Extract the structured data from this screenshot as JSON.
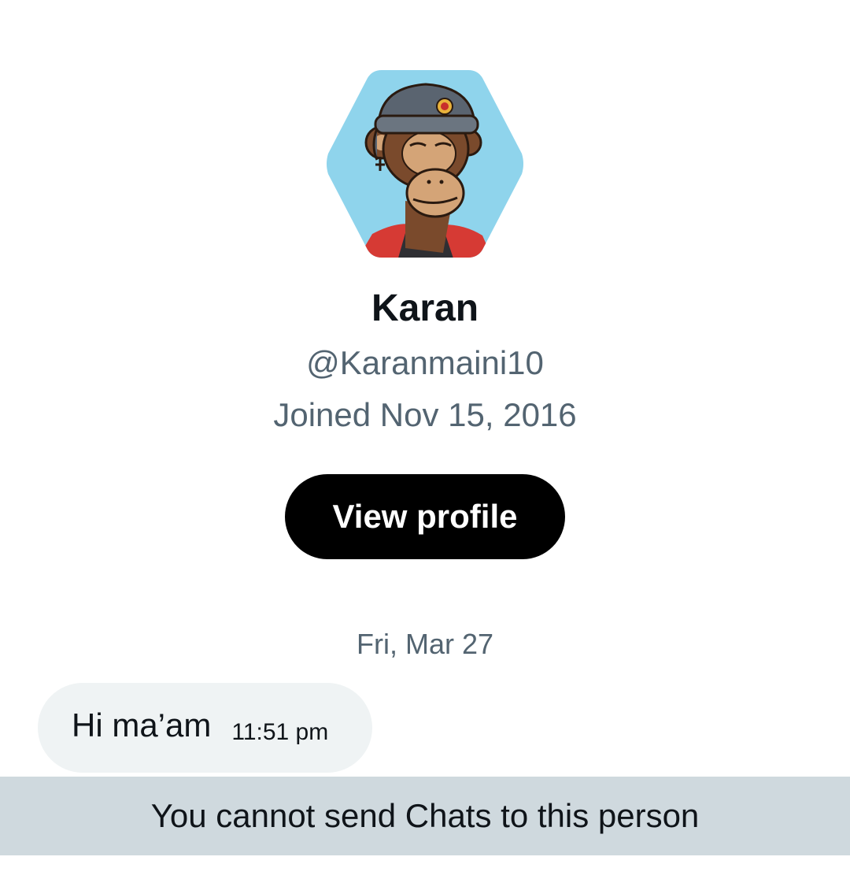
{
  "profile": {
    "avatar_icon": "bored-ape-avatar",
    "name": "Karan",
    "handle": "@Karanmaini10",
    "joined": "Joined Nov 15, 2016",
    "view_profile_label": "View profile"
  },
  "conversation": {
    "date_separator": "Fri, Mar 27",
    "messages": [
      {
        "text": "Hi ma’am",
        "time": "11:51 pm"
      }
    ]
  },
  "footer": {
    "notice": "You cannot send Chats to this person"
  },
  "colors": {
    "secondary_text": "#536471",
    "primary_text": "#0f1419",
    "button_bg": "#000000",
    "bubble_bg": "#eff3f4",
    "footer_bg": "#cfd9de",
    "avatar_bg": "#8fd4ec"
  }
}
